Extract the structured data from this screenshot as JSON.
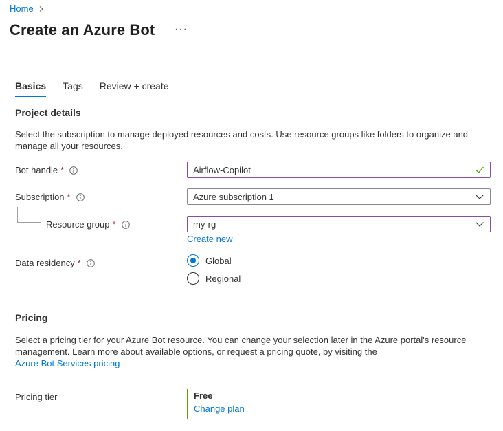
{
  "breadcrumb": {
    "home": "Home"
  },
  "page": {
    "title": "Create an Azure Bot",
    "more": "···"
  },
  "tabs": [
    {
      "label": "Basics",
      "active": true
    },
    {
      "label": "Tags",
      "active": false
    },
    {
      "label": "Review + create",
      "active": false
    }
  ],
  "project": {
    "heading": "Project details",
    "description_line1": "Select the subscription to manage deployed resources and costs. Use resource groups like folders to organize and",
    "description_line2": "manage all your resources."
  },
  "form": {
    "bot_handle": {
      "label": "Bot handle",
      "required": "*",
      "value": "Airflow-Copilot"
    },
    "subscription": {
      "label": "Subscription",
      "required": "*",
      "value": "Azure subscription 1"
    },
    "resource_group": {
      "label": "Resource group",
      "required": "*",
      "value": "my-rg",
      "create_new": "Create new"
    },
    "data_residency": {
      "label": "Data residency",
      "required": "*",
      "options": [
        {
          "label": "Global",
          "selected": true
        },
        {
          "label": "Regional",
          "selected": false
        }
      ]
    }
  },
  "pricing": {
    "heading": "Pricing",
    "description_line1": "Select a pricing tier for your Azure Bot resource. You can change your selection later in the Azure portal's resource",
    "description_line2": "management. Learn more about available options, or request a pricing quote, by visiting the",
    "pricing_link": "Azure Bot Services pricing",
    "tier_label": "Pricing tier",
    "tier_name": "Free",
    "change_plan": "Change plan"
  },
  "colors": {
    "accent": "#0078d4",
    "focus_border": "#8a4c9f",
    "valid_check": "#57a300",
    "required": "#a4262c"
  }
}
